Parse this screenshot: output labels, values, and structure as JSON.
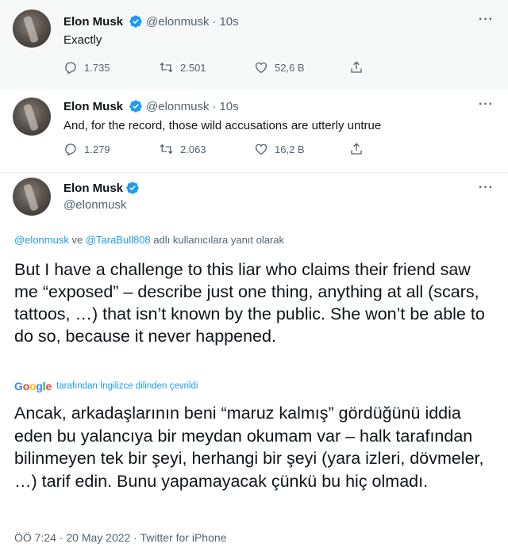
{
  "tweets": [
    {
      "name": "Elon Musk",
      "handle": "@elonmusk",
      "separator": "·",
      "time": "10s",
      "text": "Exactly",
      "replies": "1.735",
      "retweets": "2.501",
      "likes": "52,6 B",
      "more": "···"
    },
    {
      "name": "Elon Musk",
      "handle": "@elonmusk",
      "separator": "·",
      "time": "10s",
      "text": "And, for the record, those wild accusations are utterly untrue",
      "replies": "1.279",
      "retweets": "2.063",
      "likes": "16,2 B",
      "more": "···"
    }
  ],
  "detail": {
    "name": "Elon Musk",
    "handle": "@elonmusk",
    "more": "···",
    "reply_to_1": "@elonmusk",
    "reply_and": " ve ",
    "reply_to_2": "@TaraBull808",
    "reply_suffix": " adlı kullanıcılara yanıt olarak",
    "text": "But I have a challenge to this liar who claims their friend saw me “exposed” – describe just one thing, anything at all (scars, tattoos, …) that isn’t known by the public. She won’t be able to do so, because it never happened.",
    "google_logo": "Google",
    "translation_credit": "tarafından İngilizce dilinden çevrildi",
    "translated_text": "Ancak, arkadaşlarının beni “maruz kalmış” gördüğünü iddia eden bu yalancıya bir meydan okumam var – halk tarafından bilinmeyen tek bir şeyi, herhangi bir şeyi (yara izleri, dövmeler, …) tarif edin. Bunu yapamayacak çünkü bu hiç olmadı.",
    "meta": "ÖÖ 7:24 · 20 May 2022 · Twitter for iPhone"
  },
  "colors": {
    "accent": "#1d9bf0",
    "muted": "#536471",
    "text": "#0f1419"
  },
  "icons": [
    "verified-badge-icon",
    "reply-icon",
    "retweet-icon",
    "like-icon",
    "share-icon",
    "more-icon"
  ]
}
